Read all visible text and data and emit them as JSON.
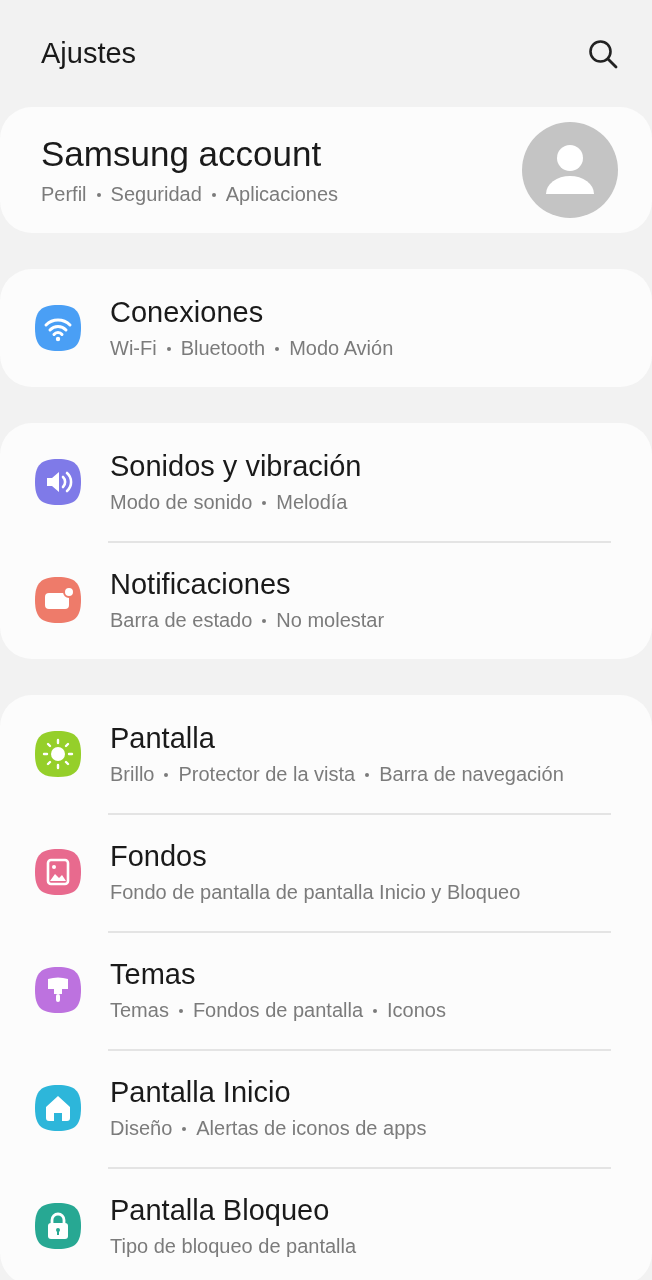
{
  "header": {
    "title": "Ajustes"
  },
  "account": {
    "title": "Samsung account",
    "subtitles": [
      "Perfil",
      "Seguridad",
      "Aplicaciones"
    ]
  },
  "groups": [
    {
      "items": [
        {
          "kind": "wifi",
          "color": "#4a9ff5",
          "title": "Conexiones",
          "subtitles": [
            "Wi-Fi",
            "Bluetooth",
            "Modo Avión"
          ]
        }
      ]
    },
    {
      "items": [
        {
          "kind": "sound",
          "color": "#7f7ae8",
          "title": "Sonidos y vibración",
          "subtitles": [
            "Modo de sonido",
            "Melodía"
          ]
        },
        {
          "kind": "notification",
          "color": "#ee7b6a",
          "title": "Notificaciones",
          "subtitles": [
            "Barra de estado",
            "No molestar"
          ]
        }
      ]
    },
    {
      "items": [
        {
          "kind": "display",
          "color": "#95cf2a",
          "title": "Pantalla",
          "subtitles": [
            "Brillo",
            "Protector de la vista",
            "Barra de navegación"
          ]
        },
        {
          "kind": "wallpaper",
          "color": "#e86a8e",
          "title": "Fondos",
          "subtitles": [
            "Fondo de pantalla de pantalla Inicio y Bloqueo"
          ]
        },
        {
          "kind": "themes",
          "color": "#bd72df",
          "title": "Temas",
          "subtitles": [
            "Temas",
            "Fondos de pantalla",
            "Iconos"
          ]
        },
        {
          "kind": "home",
          "color": "#2db6da",
          "title": "Pantalla Inicio",
          "subtitles": [
            "Diseño",
            "Alertas de iconos de apps"
          ]
        },
        {
          "kind": "lock",
          "color": "#27a893",
          "title": "Pantalla Bloqueo",
          "subtitles": [
            "Tipo de bloqueo de pantalla"
          ]
        }
      ]
    }
  ]
}
